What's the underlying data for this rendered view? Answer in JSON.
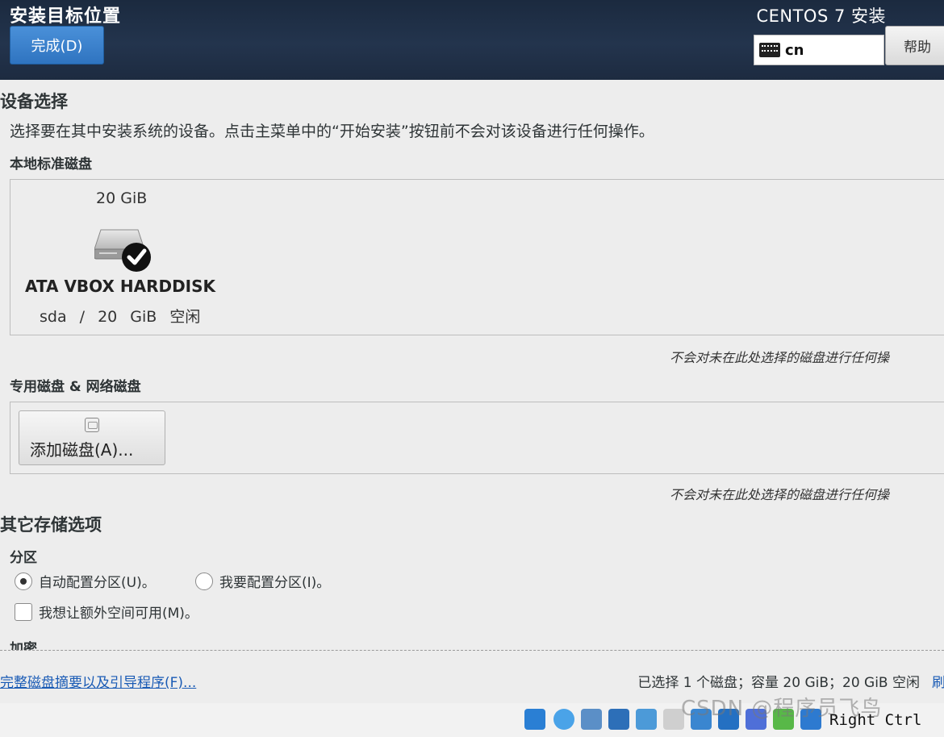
{
  "header": {
    "title": "安装目标位置",
    "done_label": "完成(D)",
    "product": "CENTOS 7 安装",
    "keyboard_layout": "cn",
    "help_label": "帮助"
  },
  "device_selection": {
    "heading": "设备选择",
    "description": "选择要在其中安装系统的设备。点击主菜单中的“开始安装”按钮前不会对该设备进行任何操作。",
    "local_disks_heading": "本地标准磁盘",
    "disk": {
      "size": "20 GiB",
      "name": "ATA VBOX HARDDISK",
      "info": "sda / 20 GiB 空闲",
      "selected": true
    },
    "local_note": "不会对未在此处选择的磁盘进行任何操",
    "special_disks_heading": "专用磁盘 & 网络磁盘",
    "add_disk_label": "添加磁盘(A)...",
    "special_note": "不会对未在此处选择的磁盘进行任何操"
  },
  "other_storage": {
    "heading": "其它存储选项",
    "partition_heading": "分区",
    "auto_partition_label": "自动配置分区(U)。",
    "manual_partition_label": "我要配置分区(I)。",
    "partition_choice": "auto",
    "extra_space_label": "我想让额外空间可用(M)。",
    "extra_space_checked": false,
    "encryption_heading": "加密"
  },
  "footer": {
    "summary_link": "完整磁盘摘要以及引导程序(F)...",
    "status": "已选择 1 个磁盘；容量 20 GiB；20 GiB 空闲",
    "reset_link": "刷"
  },
  "vbox": {
    "watermark": "CSDN @程序员飞鸟",
    "host_key": "Right Ctrl",
    "tray_icons": [
      "hard-disk-icon",
      "optical-disk-icon",
      "audio-icon",
      "network-icon",
      "usb-icon",
      "shared-folder-icon",
      "display-icon",
      "screen-capture-icon",
      "virtualization-icon",
      "cpu-icon",
      "arrow-down-icon"
    ]
  },
  "colors": {
    "header_bg": "#1f2e44",
    "done_button": "#3b82cf",
    "link": "#1a5bb5",
    "background": "#ededed"
  }
}
